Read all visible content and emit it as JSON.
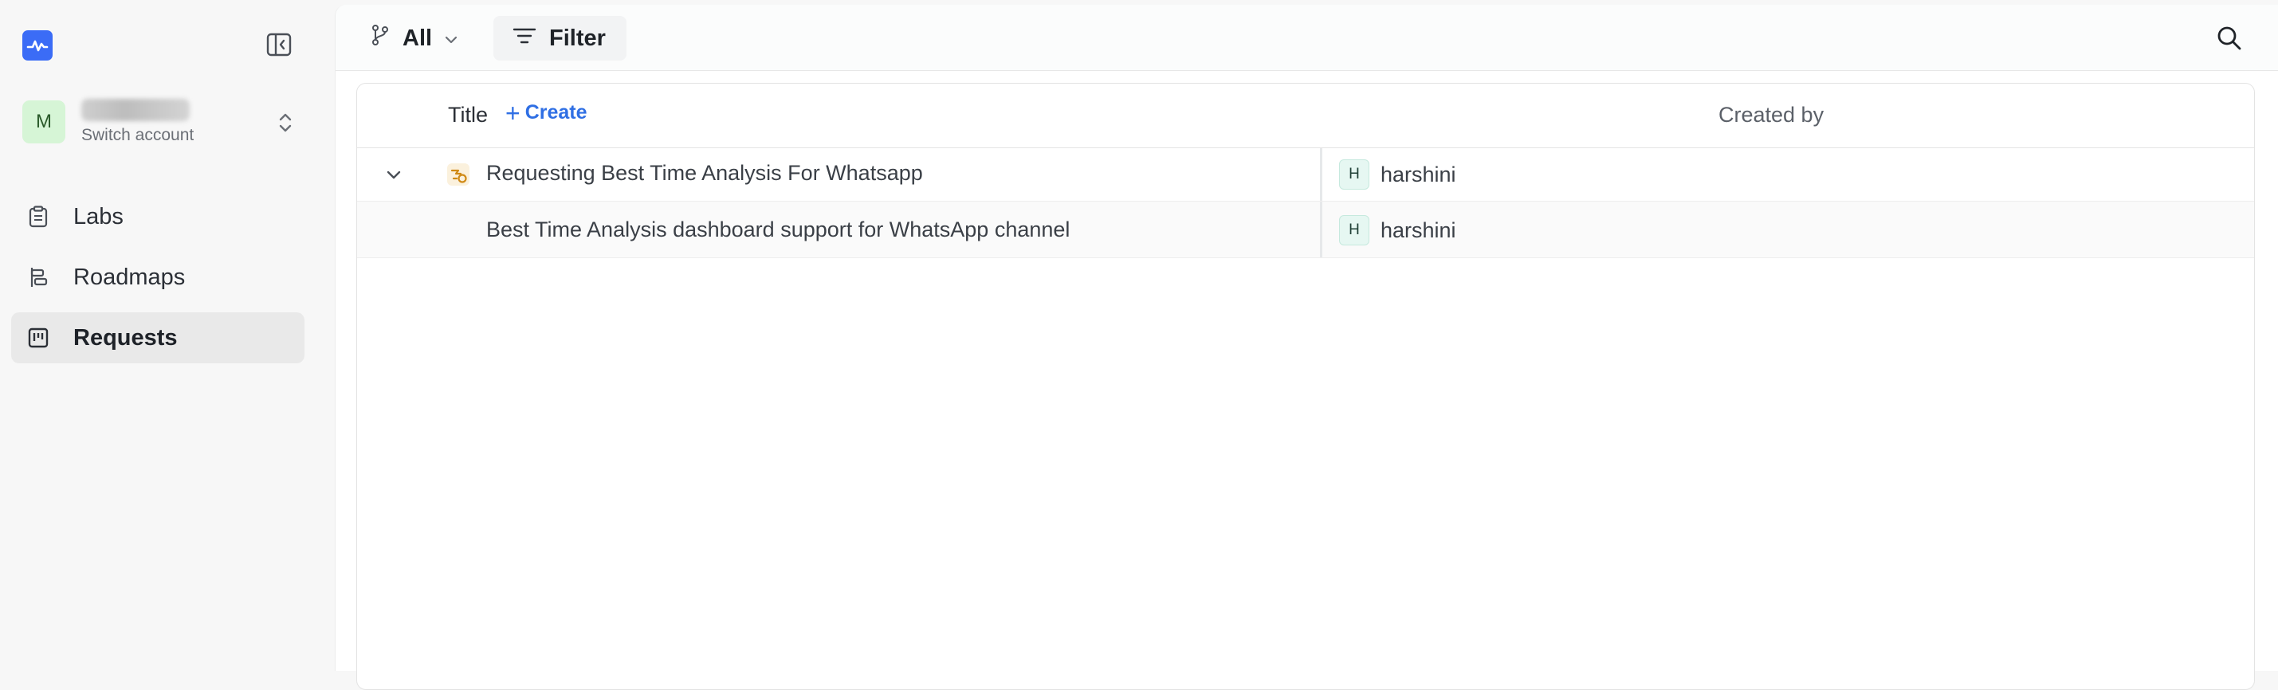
{
  "sidebar": {
    "logo_icon": "activity-logo-icon",
    "collapse_icon": "sidebar-collapse-icon",
    "account": {
      "initial": "M",
      "subtitle": "Switch account",
      "switch_icon": "chevron-up-down-icon"
    },
    "items": [
      {
        "label": "Labs",
        "icon": "clipboard-icon",
        "active": false
      },
      {
        "label": "Roadmaps",
        "icon": "roadmap-icon",
        "active": false
      },
      {
        "label": "Requests",
        "icon": "board-icon",
        "active": true
      }
    ]
  },
  "toolbar": {
    "branch_label": "All",
    "filter_label": "Filter",
    "search_icon": "search-icon"
  },
  "table": {
    "columns": {
      "title": "Title",
      "create": "Create",
      "created_by": "Created by"
    },
    "rows": [
      {
        "title": "Requesting Best Time Analysis For Whatsapp",
        "creator_initial": "H",
        "creator": "harshini",
        "expandable": true
      },
      {
        "title": "Best Time Analysis dashboard support for WhatsApp channel",
        "creator_initial": "H",
        "creator": "harshini",
        "expandable": false
      }
    ]
  },
  "colors": {
    "accent": "#2f6fe4",
    "logo": "#3b6cf6",
    "active_nav": "#e9e9e9"
  }
}
